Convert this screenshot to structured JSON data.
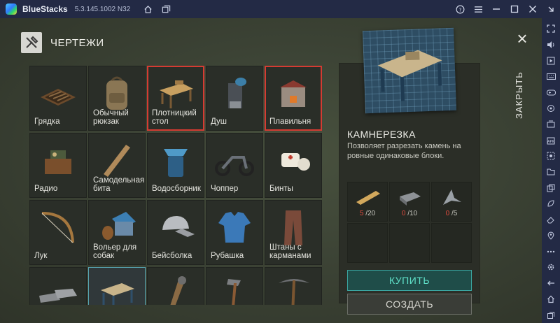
{
  "titlebar": {
    "app_name": "BlueStacks",
    "version": "5.3.145.1002 N32"
  },
  "game": {
    "header_title": "ЧЕРТЕЖИ",
    "close_label": "ЗАКРЫТЬ",
    "grid_items": [
      {
        "label": "Грядка",
        "icon": "garden-bed-icon"
      },
      {
        "label": "Обычный рюкзак",
        "icon": "backpack-icon"
      },
      {
        "label": "Плотницкий стол",
        "icon": "carpentry-table-icon",
        "highlight": "red"
      },
      {
        "label": "Душ",
        "icon": "shower-icon"
      },
      {
        "label": "Плавильня",
        "icon": "smelter-icon",
        "highlight": "red"
      },
      {
        "label": "Радио",
        "icon": "radio-icon"
      },
      {
        "label": "Самодельная бита",
        "icon": "bat-icon"
      },
      {
        "label": "Водосборник",
        "icon": "water-collector-icon"
      },
      {
        "label": "Чоппер",
        "icon": "chopper-icon"
      },
      {
        "label": "Бинты",
        "icon": "bandage-icon"
      },
      {
        "label": "Лук",
        "icon": "bow-icon"
      },
      {
        "label": "Вольер для собак",
        "icon": "dog-kennel-icon"
      },
      {
        "label": "Бейсболка",
        "icon": "cap-icon"
      },
      {
        "label": "Рубашка",
        "icon": "shirt-icon"
      },
      {
        "label": "Штаны с карманами",
        "icon": "pants-icon"
      },
      {
        "label": "",
        "icon": "sneakers-icon"
      },
      {
        "label": "",
        "icon": "stonecutter-icon",
        "highlight": "blue"
      },
      {
        "label": "",
        "icon": "club-icon"
      },
      {
        "label": "",
        "icon": "hammer-icon"
      },
      {
        "label": "",
        "icon": "pickaxe-icon"
      }
    ],
    "detail": {
      "name": "КАМНЕРЕЗКА",
      "description": "Позволяет разрезать камень на ровные одинаковые блоки.",
      "resources": [
        {
          "icon": "planks-icon",
          "have": "5",
          "need": "/20"
        },
        {
          "icon": "iron-ingot-icon",
          "have": "0",
          "need": "/10"
        },
        {
          "icon": "metal-parts-icon",
          "have": "0",
          "need": "/5"
        }
      ],
      "buy_label": "КУПИТЬ",
      "create_label": "СОЗДАТЬ"
    }
  },
  "colors": {
    "red_highlight": "#d53b32",
    "buy_accent": "#5fe0c8",
    "resource_missing": "#e04b3e"
  }
}
